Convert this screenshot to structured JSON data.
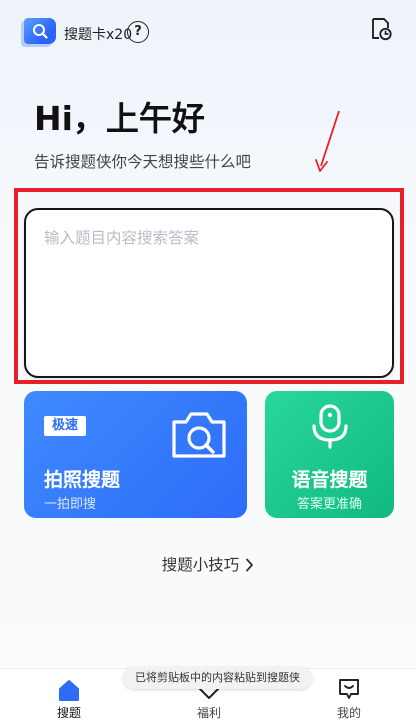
{
  "header": {
    "card_count": "搜题卡x20",
    "help": "?"
  },
  "greeting": "Hi，上午好",
  "subtitle": "告诉搜题侠你今天想搜些什么吧",
  "search": {
    "placeholder": "输入题目内容搜索答案",
    "value": ""
  },
  "photo_search": {
    "badge": "极速",
    "title": "拍照搜题",
    "subtitle": "一拍即搜"
  },
  "voice_search": {
    "title": "语音搜题",
    "subtitle": "答案更准确"
  },
  "tips_link": "搜题小技巧",
  "toast": "已将剪贴板中的内容粘贴到搜题侠",
  "nav": {
    "search": "搜题",
    "welfare": "福利",
    "mine": "我的"
  },
  "colors": {
    "accent_blue": "#2d6cf7",
    "accent_green": "#11b97f",
    "highlight_red": "#e8202a"
  }
}
